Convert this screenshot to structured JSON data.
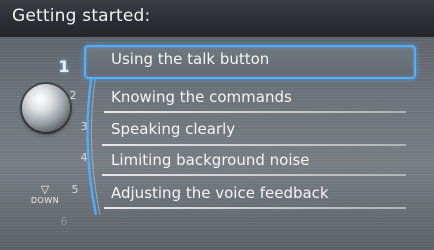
{
  "title": "Getting started:",
  "menu": {
    "numbers": [
      "1",
      "2",
      "3",
      "4",
      "5",
      "6"
    ],
    "items": [
      "Using the talk button",
      "Knowing the commands",
      "Speaking clearly",
      "Limiting background noise",
      "Adjusting the voice feedback"
    ],
    "selected_index": 0
  },
  "scroll": {
    "down_label": "DOWN",
    "down_icon": "triangle-down"
  },
  "colors": {
    "selection": "#4fb0ff",
    "title_bar": "#2a2d33",
    "text": "#f5f5f5"
  }
}
